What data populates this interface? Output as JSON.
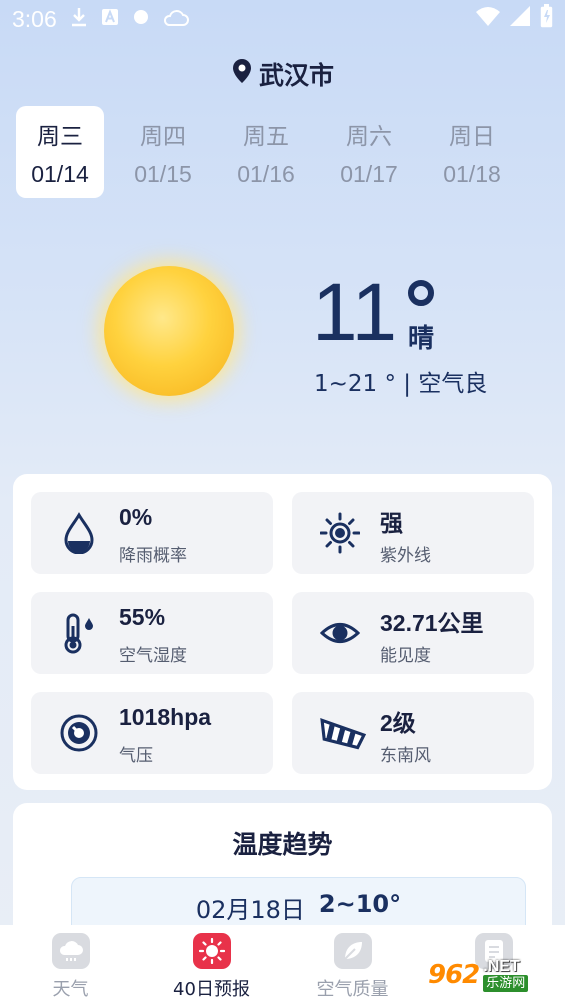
{
  "status_bar": {
    "time": "3:06",
    "icons": [
      "download-icon",
      "a-icon",
      "dot-icon",
      "cloud-icon",
      "wifi-icon",
      "signal-icon",
      "battery-icon"
    ]
  },
  "location": {
    "city": "武汉市",
    "icon": "location-pin-icon"
  },
  "days": [
    {
      "weekday": "周三",
      "date": "01/14",
      "active": true
    },
    {
      "weekday": "周四",
      "date": "01/15",
      "active": false
    },
    {
      "weekday": "周五",
      "date": "01/16",
      "active": false
    },
    {
      "weekday": "周六",
      "date": "01/17",
      "active": false
    },
    {
      "weekday": "周日",
      "date": "01/18",
      "active": false
    }
  ],
  "current": {
    "temperature": "11",
    "condition": "晴",
    "range_air": "1~21 ° | 空气良"
  },
  "details": [
    {
      "value": "0%",
      "label": "降雨概率",
      "icon": "raindrop-icon"
    },
    {
      "value": "强",
      "label": "紫外线",
      "icon": "sun-uv-icon"
    },
    {
      "value": "55%",
      "label": "空气湿度",
      "icon": "thermometer-humidity-icon"
    },
    {
      "value": "32.71公里",
      "label": "能见度",
      "icon": "eye-icon"
    },
    {
      "value": "1018hpa",
      "label": "气压",
      "icon": "pressure-gauge-icon"
    },
    {
      "value": "2级",
      "label": "东南风",
      "icon": "windsock-icon"
    }
  ],
  "trend": {
    "title": "温度趋势",
    "row": {
      "date": "02月18日",
      "range": "2~10°"
    }
  },
  "tabs": [
    {
      "label": "天气",
      "icon": "weather-cloud-icon",
      "active": false
    },
    {
      "label": "40日预报",
      "icon": "forecast-40-icon",
      "active": true
    },
    {
      "label": "空气质量",
      "icon": "leaf-icon",
      "active": false
    },
    {
      "label": "",
      "icon": "document-icon",
      "active": false
    }
  ],
  "watermark": {
    "logo": "962",
    "net": ".NET",
    "cn": "乐游网"
  },
  "colors": {
    "accent": "#e8324a",
    "text_dark": "#1a2140",
    "temp_blue": "#1a3060"
  }
}
